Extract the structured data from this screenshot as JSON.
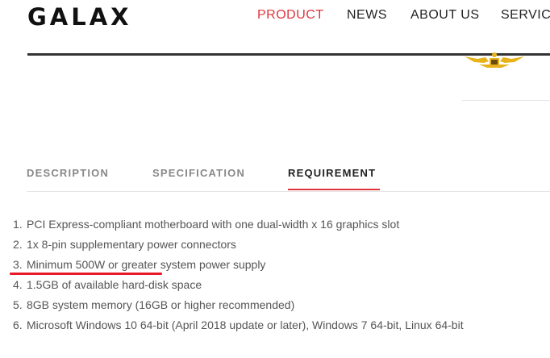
{
  "header": {
    "logo": "GALAX",
    "nav": [
      "PRODUCT",
      "NEWS",
      "ABOUT US",
      "SERVIC"
    ]
  },
  "colors": {
    "accent": "#e0343d",
    "highlight": "#e81a2a"
  },
  "tabs": [
    "DESCRIPTION",
    "SPECIFICATION",
    "REQUIREMENT"
  ],
  "active_tab": "REQUIREMENT",
  "requirements": [
    {
      "num": "1.",
      "text": "PCI Express-compliant motherboard with one dual-width x 16 graphics slot"
    },
    {
      "num": "2.",
      "text": "1x 8-pin supplementary power connectors"
    },
    {
      "num": "3.",
      "text": "Minimum 500W or greater system power supply"
    },
    {
      "num": "4.",
      "text": "1.5GB of available hard-disk space"
    },
    {
      "num": "5.",
      "text": "8GB system memory (16GB or higher recommended)"
    },
    {
      "num": "6.",
      "text": "Microsoft Windows 10 64-bit (April 2018 update or later), Windows 7 64-bit, Linux 64-bit"
    }
  ]
}
